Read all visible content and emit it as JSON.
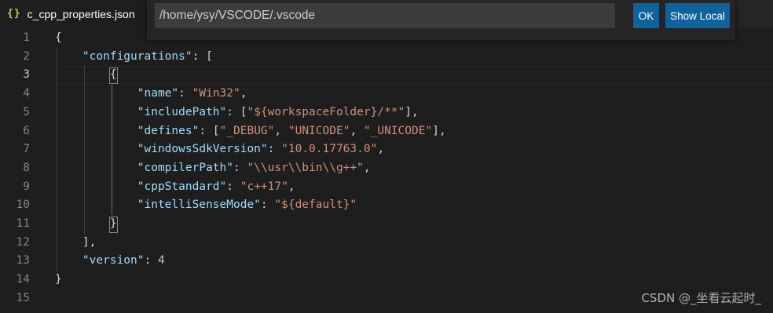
{
  "tab": {
    "icon": "json-icon",
    "icon_glyph": "{}",
    "title": "c_cpp_properties.json"
  },
  "quick_pick": {
    "value": "/home/ysy/VSCODE/.vscode",
    "ok_label": "OK",
    "show_local_label": "Show Local"
  },
  "editor": {
    "active_line": 3,
    "line_numbers": [
      "1",
      "2",
      "3",
      "4",
      "5",
      "6",
      "7",
      "8",
      "9",
      "10",
      "11",
      "12",
      "13",
      "14",
      "15"
    ],
    "lines": [
      [
        {
          "t": "{",
          "c": "p"
        }
      ],
      [
        {
          "t": "    ",
          "c": "p"
        },
        {
          "t": "\"configurations\"",
          "c": "k"
        },
        {
          "t": ": [",
          "c": "p"
        }
      ],
      [
        {
          "t": "        ",
          "c": "p"
        },
        {
          "t": "{",
          "c": "p"
        }
      ],
      [
        {
          "t": "            ",
          "c": "p"
        },
        {
          "t": "\"name\"",
          "c": "k"
        },
        {
          "t": ": ",
          "c": "p"
        },
        {
          "t": "\"Win32\"",
          "c": "s"
        },
        {
          "t": ",",
          "c": "p"
        }
      ],
      [
        {
          "t": "            ",
          "c": "p"
        },
        {
          "t": "\"includePath\"",
          "c": "k"
        },
        {
          "t": ": [",
          "c": "p"
        },
        {
          "t": "\"${workspaceFolder}/**\"",
          "c": "s"
        },
        {
          "t": "],",
          "c": "p"
        }
      ],
      [
        {
          "t": "            ",
          "c": "p"
        },
        {
          "t": "\"defines\"",
          "c": "k"
        },
        {
          "t": ": [",
          "c": "p"
        },
        {
          "t": "\"_DEBUG\"",
          "c": "s"
        },
        {
          "t": ", ",
          "c": "p"
        },
        {
          "t": "\"UNICODE\"",
          "c": "s"
        },
        {
          "t": ", ",
          "c": "p"
        },
        {
          "t": "\"_UNICODE\"",
          "c": "s"
        },
        {
          "t": "],",
          "c": "p"
        }
      ],
      [
        {
          "t": "            ",
          "c": "p"
        },
        {
          "t": "\"windowsSdkVersion\"",
          "c": "k"
        },
        {
          "t": ": ",
          "c": "p"
        },
        {
          "t": "\"10.0.17763.0\"",
          "c": "s"
        },
        {
          "t": ",",
          "c": "p"
        }
      ],
      [
        {
          "t": "            ",
          "c": "p"
        },
        {
          "t": "\"compilerPath\"",
          "c": "k"
        },
        {
          "t": ": ",
          "c": "p"
        },
        {
          "t": "\"\\\\usr\\\\bin\\\\g++\"",
          "c": "s"
        },
        {
          "t": ",",
          "c": "p"
        }
      ],
      [
        {
          "t": "            ",
          "c": "p"
        },
        {
          "t": "\"cppStandard\"",
          "c": "k"
        },
        {
          "t": ": ",
          "c": "p"
        },
        {
          "t": "\"c++17\"",
          "c": "s"
        },
        {
          "t": ",",
          "c": "p"
        }
      ],
      [
        {
          "t": "            ",
          "c": "p"
        },
        {
          "t": "\"intelliSenseMode\"",
          "c": "k"
        },
        {
          "t": ": ",
          "c": "p"
        },
        {
          "t": "\"${default}\"",
          "c": "s"
        }
      ],
      [
        {
          "t": "        ",
          "c": "p"
        },
        {
          "t": "}",
          "c": "p"
        }
      ],
      [
        {
          "t": "    ",
          "c": "p"
        },
        {
          "t": "],",
          "c": "p"
        }
      ],
      [
        {
          "t": "    ",
          "c": "p"
        },
        {
          "t": "\"version\"",
          "c": "k"
        },
        {
          "t": ": ",
          "c": "p"
        },
        {
          "t": "4",
          "c": "n"
        }
      ],
      [
        {
          "t": "}",
          "c": "p"
        }
      ],
      []
    ]
  },
  "watermark": "CSDN @_坐看云起时_",
  "colors": {
    "editor_bg": "#1e1e1e",
    "key": "#9cdcfe",
    "string": "#ce9178",
    "number": "#b5cea8",
    "button": "#0e639c"
  }
}
